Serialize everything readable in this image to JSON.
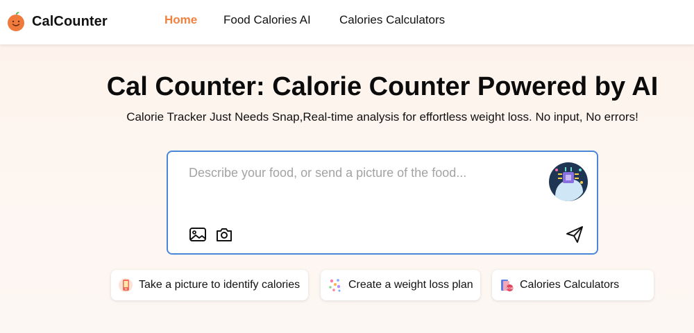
{
  "brand": {
    "name": "CalCounter",
    "logo_icon": "orange-smiley-icon",
    "accent_color": "#f0813f"
  },
  "nav": {
    "items": [
      {
        "label": "Home",
        "active": true
      },
      {
        "label": "Food Calories AI",
        "active": false
      },
      {
        "label": "Calories Calculators",
        "active": false
      }
    ]
  },
  "hero": {
    "title": "Cal Counter: Calorie Counter Powered by AI",
    "subtitle": "Calorie Tracker Just Needs Snap,Real-time analysis for effortless weight loss. No input, No errors!"
  },
  "input": {
    "placeholder": "Describe your food, or send a picture of the food...",
    "value": "",
    "border_color": "#4a86d8",
    "icons": [
      "image-upload-icon",
      "camera-icon",
      "send-icon",
      "ai-brain-avatar-icon"
    ]
  },
  "suggestions": [
    {
      "label": "Take a picture to identify calories",
      "icon": "phone-photo-icon"
    },
    {
      "label": "Create a weight loss plan",
      "icon": "plan-dots-icon"
    },
    {
      "label": "Calories Calculators",
      "icon": "calculator-book-icon"
    }
  ]
}
